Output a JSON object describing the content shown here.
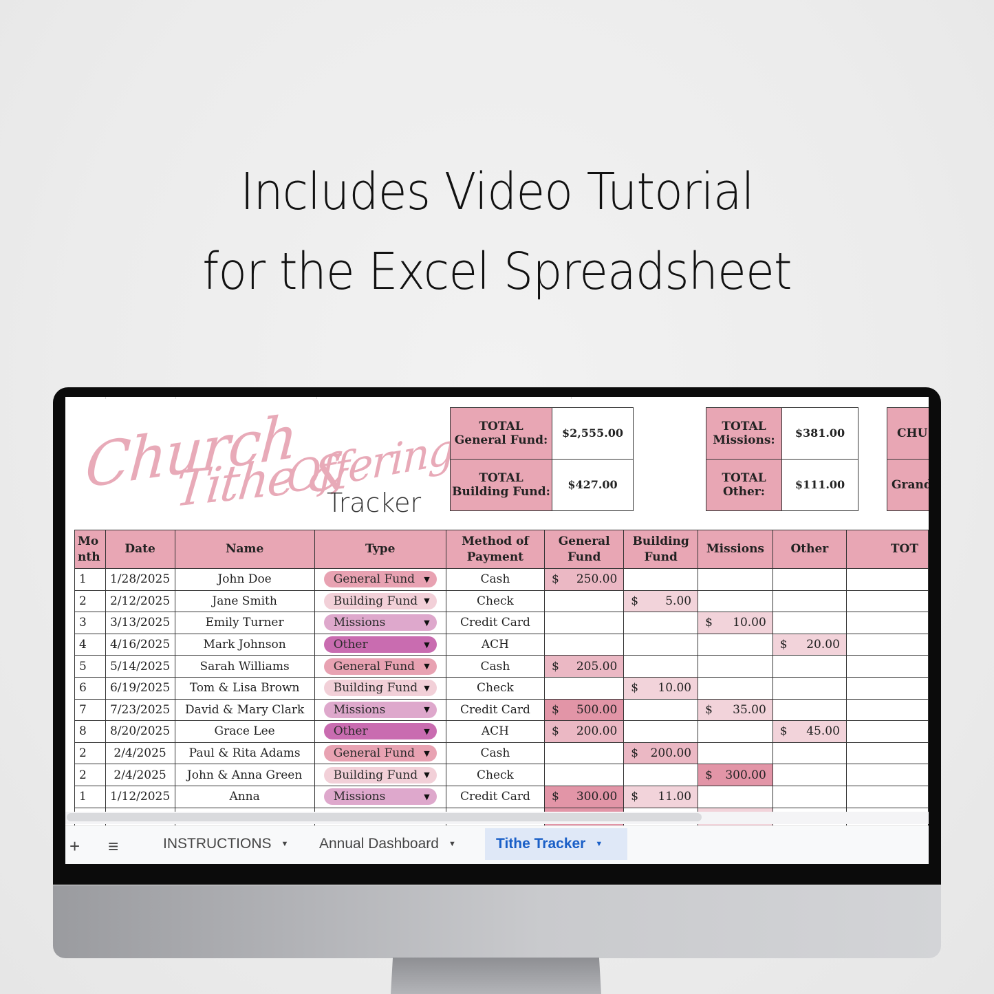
{
  "headline": {
    "line1": "Includes Video Tutorial",
    "line2": "for the Excel Spreadsheet"
  },
  "logo": {
    "word1": "Church",
    "word2": "Tithe &",
    "word3": "Offering",
    "word4": "Tracker",
    "script_color": "#e8aab8"
  },
  "summary": {
    "general_fund": {
      "label_top": "TOTAL",
      "label_bottom": "General Fund:",
      "value": "$2,555.00"
    },
    "building_fund": {
      "label_top": "TOTAL",
      "label_bottom": "Building Fund:",
      "value": "$427.00"
    },
    "missions": {
      "label_top": "TOTAL",
      "label_bottom": "Missions:",
      "value": "$381.00"
    },
    "other": {
      "label_top": "TOTAL",
      "label_bottom": "Other:",
      "value": "$111.00"
    },
    "church_total": {
      "label_top": "CHU",
      "label_bottom": "Grand"
    }
  },
  "table": {
    "headers": [
      "Mo\nnth",
      "Date",
      "Name",
      "Type",
      "Method of Payment",
      "General Fund",
      "Building Fund",
      "Missions",
      "Other",
      "TOT"
    ],
    "rows": [
      {
        "month": "1",
        "date": "1/28/2025",
        "name": "John Doe",
        "type": "General Fund",
        "method": "Cash",
        "general": "250.00",
        "building": "",
        "missions": "",
        "other": ""
      },
      {
        "month": "2",
        "date": "2/12/2025",
        "name": "Jane Smith",
        "type": "Building Fund",
        "method": "Check",
        "general": "",
        "building": "5.00",
        "missions": "",
        "other": ""
      },
      {
        "month": "3",
        "date": "3/13/2025",
        "name": "Emily Turner",
        "type": "Missions",
        "method": "Credit Card",
        "general": "",
        "building": "",
        "missions": "10.00",
        "other": ""
      },
      {
        "month": "4",
        "date": "4/16/2025",
        "name": "Mark Johnson",
        "type": "Other",
        "method": "ACH",
        "general": "",
        "building": "",
        "missions": "",
        "other": "20.00"
      },
      {
        "month": "5",
        "date": "5/14/2025",
        "name": "Sarah Williams",
        "type": "General Fund",
        "method": "Cash",
        "general": "205.00",
        "building": "",
        "missions": "",
        "other": ""
      },
      {
        "month": "6",
        "date": "6/19/2025",
        "name": "Tom & Lisa Brown",
        "type": "Building Fund",
        "method": "Check",
        "general": "",
        "building": "10.00",
        "missions": "",
        "other": ""
      },
      {
        "month": "7",
        "date": "7/23/2025",
        "name": "David & Mary Clark",
        "type": "Missions",
        "method": "Credit Card",
        "general": "500.00",
        "building": "",
        "missions": "35.00",
        "other": ""
      },
      {
        "month": "8",
        "date": "8/20/2025",
        "name": "Grace Lee",
        "type": "Other",
        "method": "ACH",
        "general": "200.00",
        "building": "",
        "missions": "",
        "other": "45.00"
      },
      {
        "month": "2",
        "date": "2/4/2025",
        "name": "Paul & Rita Adams",
        "type": "General Fund",
        "method": "Cash",
        "general": "",
        "building": "200.00",
        "missions": "",
        "other": ""
      },
      {
        "month": "2",
        "date": "2/4/2025",
        "name": "John & Anna Green",
        "type": "Building Fund",
        "method": "Check",
        "general": "",
        "building": "",
        "missions": "300.00",
        "other": ""
      },
      {
        "month": "1",
        "date": "1/12/2025",
        "name": "Anna",
        "type": "Missions",
        "method": "Credit Card",
        "general": "300.00",
        "building": "11.00",
        "missions": "",
        "other": ""
      }
    ],
    "currency_symbol": "$",
    "type_colors": {
      "General Fund": "#e8a2b2",
      "Building Fund": "#f2d0d8",
      "Missions": "#dea8cc",
      "Other": "#c96cb0"
    },
    "amount_colors": {
      "low": "#f2d3da",
      "mid": "#ebb8c4",
      "high": "#e295a7"
    }
  },
  "tabbar": {
    "add_label": "+",
    "menu_label": "≡",
    "tabs": [
      {
        "label": "INSTRUCTIONS",
        "active": false
      },
      {
        "label": "Annual Dashboard",
        "active": false
      },
      {
        "label": "Tithe Tracker",
        "active": true
      }
    ],
    "caret": "▼"
  }
}
